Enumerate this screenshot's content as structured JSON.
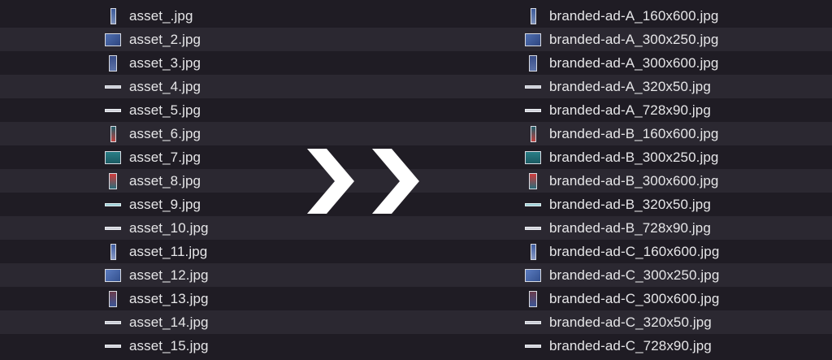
{
  "left_files": [
    {
      "name": "asset_.jpg",
      "icon": "tall"
    },
    {
      "name": "asset_2.jpg",
      "icon": "rect"
    },
    {
      "name": "asset_3.jpg",
      "icon": "tall2"
    },
    {
      "name": "asset_4.jpg",
      "icon": "bar"
    },
    {
      "name": "asset_5.jpg",
      "icon": "bar2"
    },
    {
      "name": "asset_6.jpg",
      "icon": "tallB"
    },
    {
      "name": "asset_7.jpg",
      "icon": "rectB"
    },
    {
      "name": "asset_8.jpg",
      "icon": "tall2B"
    },
    {
      "name": "asset_9.jpg",
      "icon": "barB"
    },
    {
      "name": "asset_10.jpg",
      "icon": "bar2"
    },
    {
      "name": "asset_11.jpg",
      "icon": "tallC"
    },
    {
      "name": "asset_12.jpg",
      "icon": "rectC"
    },
    {
      "name": "asset_13.jpg",
      "icon": "tall2C"
    },
    {
      "name": "asset_14.jpg",
      "icon": "bar"
    },
    {
      "name": "asset_15.jpg",
      "icon": "bar2"
    }
  ],
  "right_files": [
    {
      "name": "branded-ad-A_160x600.jpg",
      "icon": "tall"
    },
    {
      "name": "branded-ad-A_300x250.jpg",
      "icon": "rect"
    },
    {
      "name": "branded-ad-A_300x600.jpg",
      "icon": "tall2"
    },
    {
      "name": "branded-ad-A_320x50.jpg",
      "icon": "bar"
    },
    {
      "name": "branded-ad-A_728x90.jpg",
      "icon": "bar2"
    },
    {
      "name": "branded-ad-B_160x600.jpg",
      "icon": "tallB"
    },
    {
      "name": "branded-ad-B_300x250.jpg",
      "icon": "rectB"
    },
    {
      "name": "branded-ad-B_300x600.jpg",
      "icon": "tall2B"
    },
    {
      "name": "branded-ad-B_320x50.jpg",
      "icon": "barB"
    },
    {
      "name": "branded-ad-B_728x90.jpg",
      "icon": "bar2"
    },
    {
      "name": "branded-ad-C_160x600.jpg",
      "icon": "tallC"
    },
    {
      "name": "branded-ad-C_300x250.jpg",
      "icon": "rectC"
    },
    {
      "name": "branded-ad-C_300x600.jpg",
      "icon": "tall2C"
    },
    {
      "name": "branded-ad-C_320x50.jpg",
      "icon": "bar"
    },
    {
      "name": "branded-ad-C_728x90.jpg",
      "icon": "bar2"
    }
  ],
  "colors": {
    "background": "#1f1c24",
    "row_alt": "#2b2831",
    "text": "#e6e6e8",
    "chevron": "#ffffff"
  },
  "separator_icon": "double-chevron-right-icon"
}
